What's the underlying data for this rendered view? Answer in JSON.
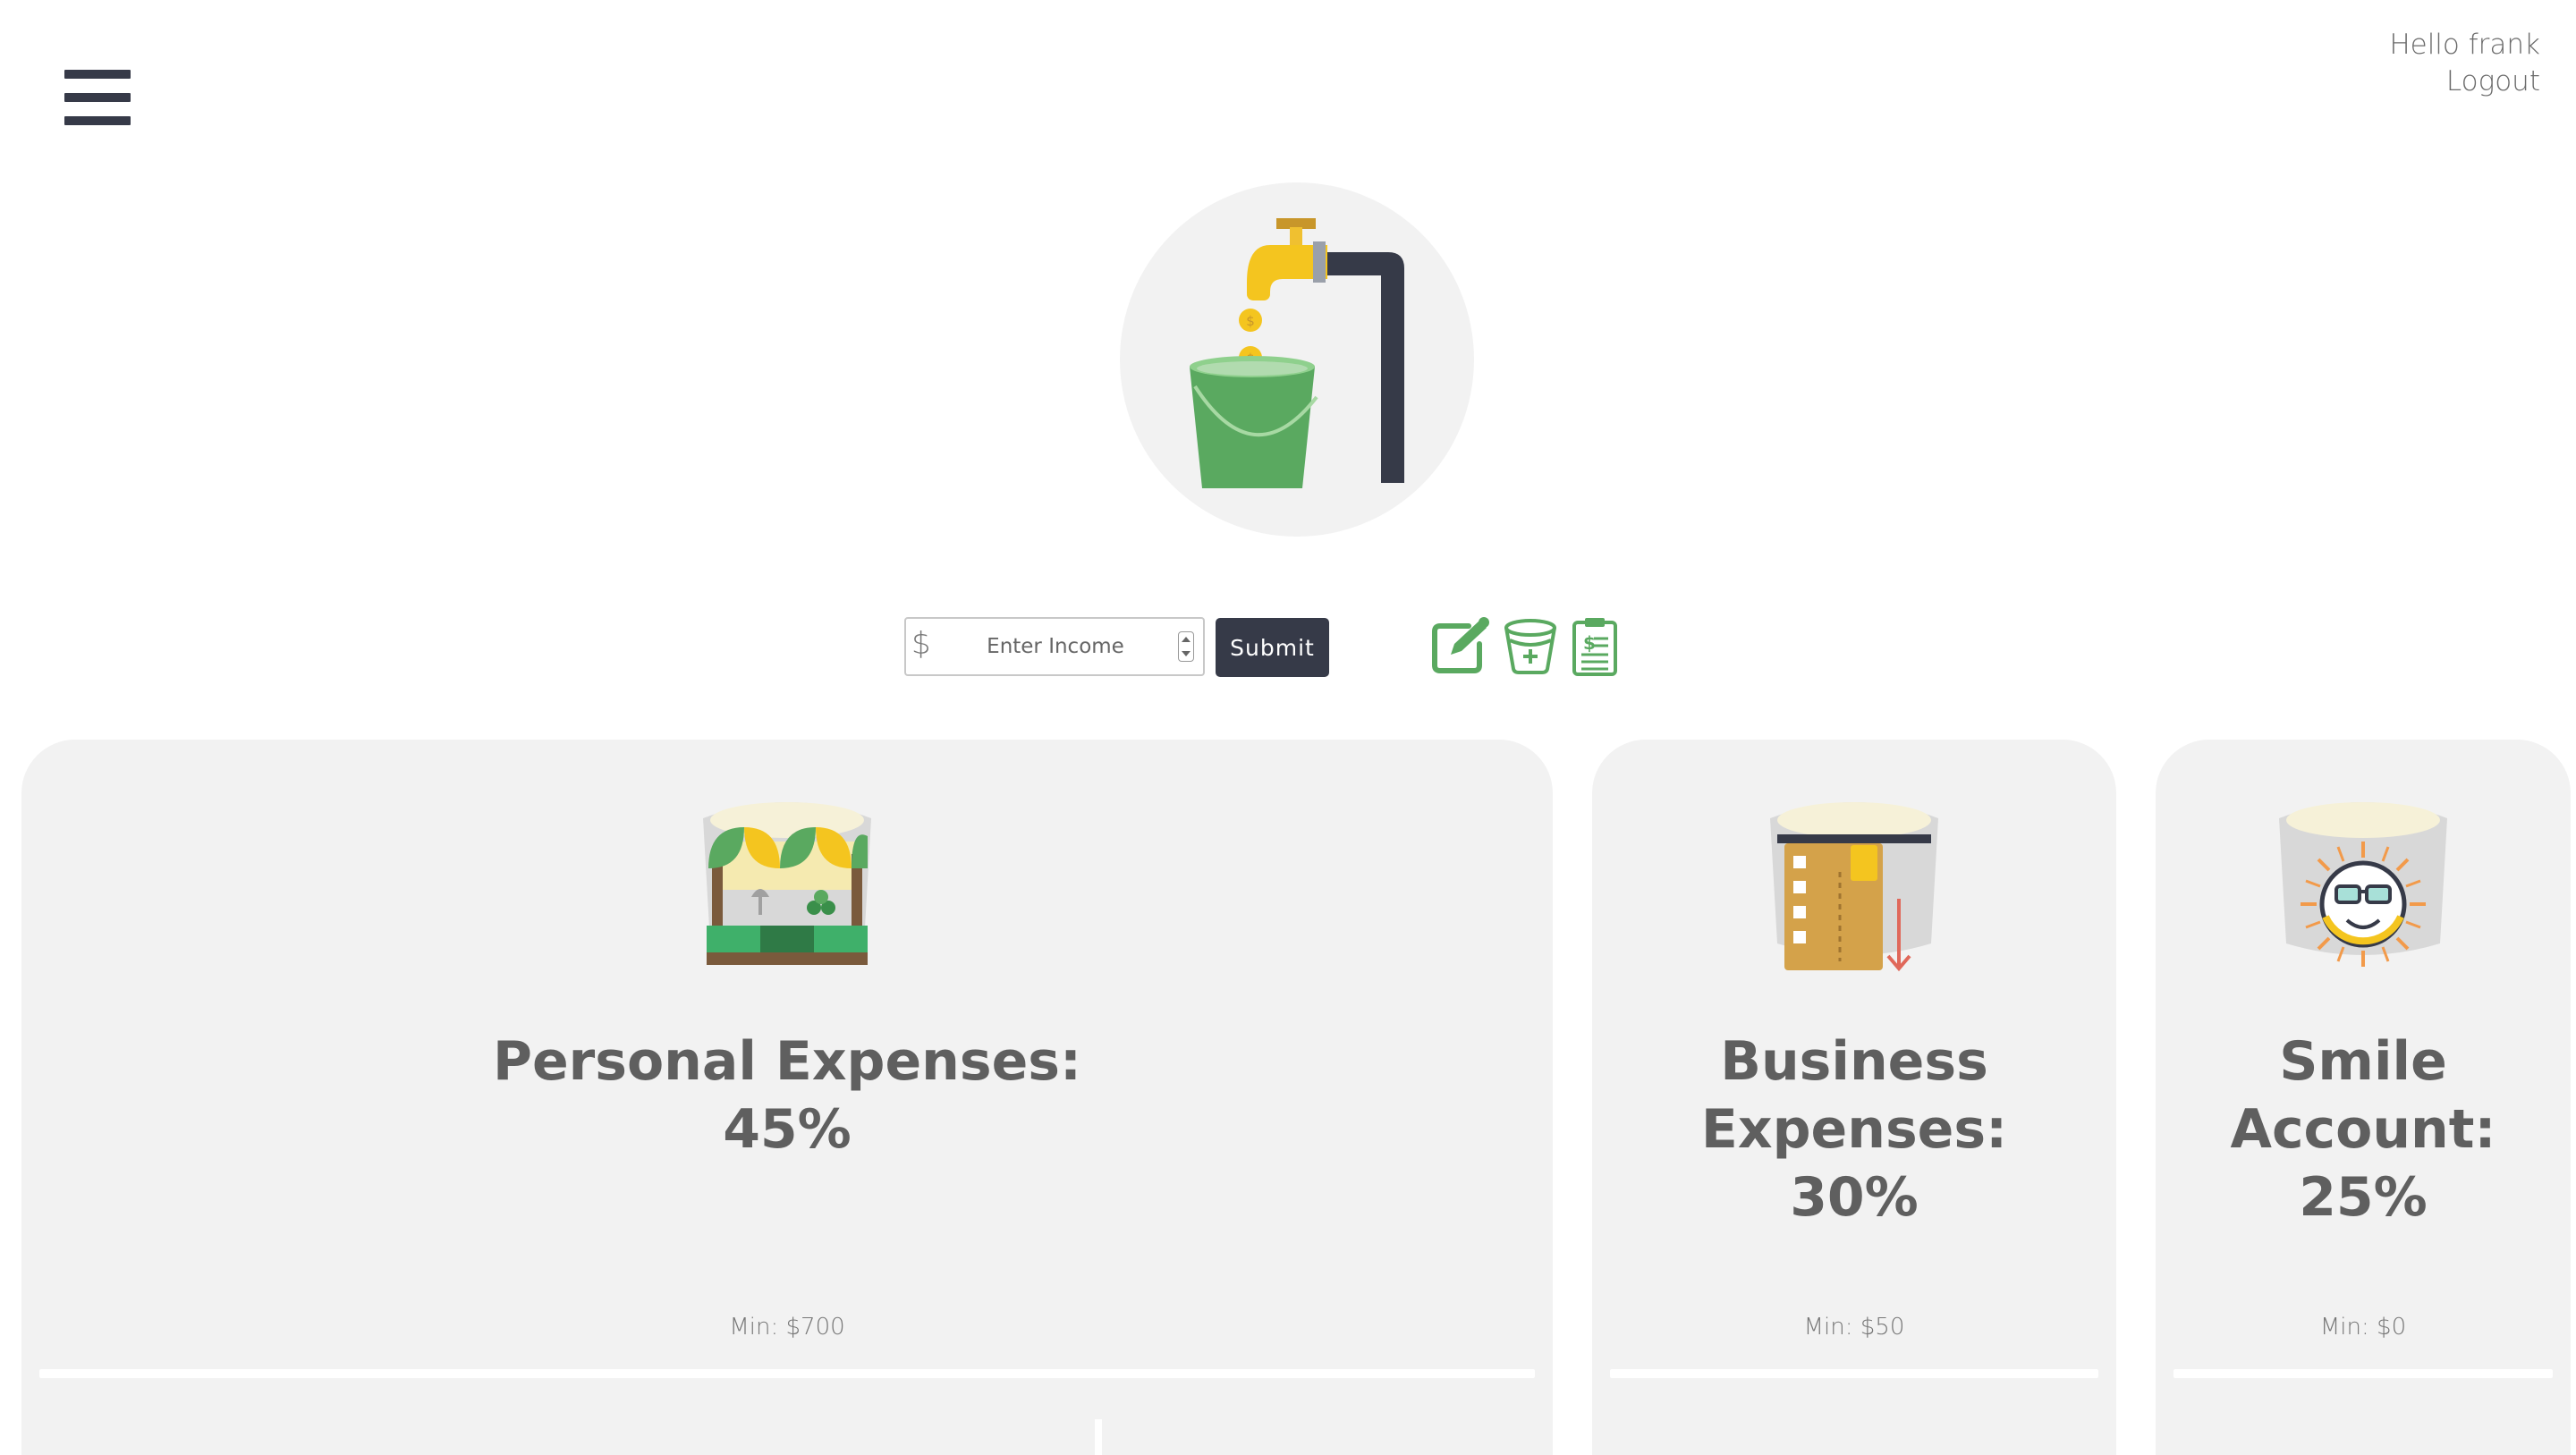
{
  "header": {
    "greeting": "Hello frank",
    "logout_label": "Logout"
  },
  "income_form": {
    "currency_symbol": "$",
    "placeholder": "Enter Income",
    "value": "",
    "submit_label": "Submit"
  },
  "toolbar": {
    "icons": [
      "edit-icon",
      "add-bucket-icon",
      "clipboard-dollar-icon"
    ]
  },
  "buckets": [
    {
      "title": "Personal Expenses:",
      "percent": "45%",
      "min": "Min: $700",
      "icon": "market-stall-bucket-icon"
    },
    {
      "title": "Business Expenses:",
      "percent": "30%",
      "min": "Min: $50",
      "icon": "credit-card-bucket-icon"
    },
    {
      "title": "Smile Account:",
      "percent": "25%",
      "min": "Min: $0",
      "icon": "smiling-sun-bucket-icon"
    }
  ],
  "colors": {
    "accent_dark": "#363a48",
    "accent_green": "#5aa960",
    "card_bg": "#f2f2f2",
    "text_gray": "#5f5f5f"
  }
}
